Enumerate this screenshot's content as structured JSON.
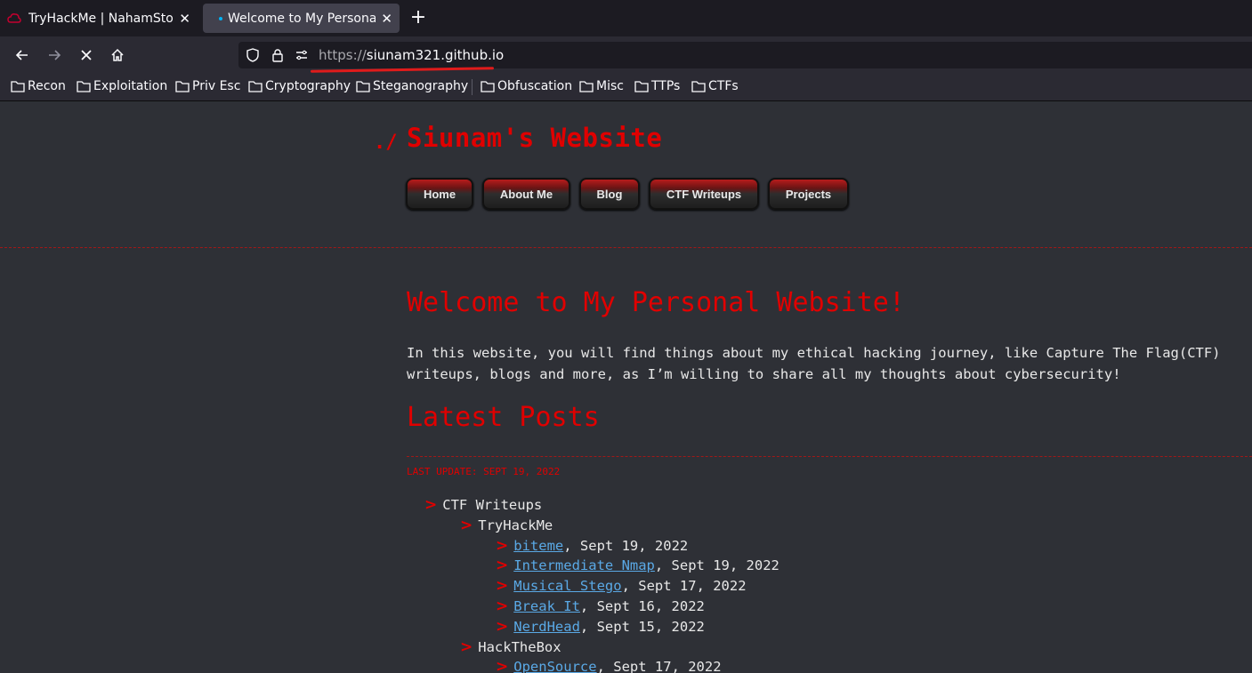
{
  "browser": {
    "tabs": [
      {
        "title": "TryHackMe | NahamStore",
        "active": false
      },
      {
        "title": "Welcome to My Personal",
        "active": true
      }
    ],
    "new_tab_label": "+",
    "url_scheme": "https://",
    "url_host": "siunam321.github.io",
    "bookmarks": [
      "Recon",
      "Exploitation",
      "Priv Esc",
      "Cryptography",
      "Steganography",
      "Obfuscation",
      "Misc",
      "TTPs",
      "CTFs"
    ]
  },
  "site": {
    "prefix": "./",
    "title": "Siunam's Website",
    "menu": [
      "Home",
      "About Me",
      "Blog",
      "CTF Writeups",
      "Projects"
    ],
    "welcome_heading": "Welcome to My Personal Website!",
    "intro_line1": "In this website, you will find things about my ethical hacking journey, like Capture The Flag(CTF)",
    "intro_line2": "writeups, blogs and more, as I’m willing to share all my thoughts about cybersecurity!",
    "latest_heading": "Latest Posts",
    "last_update": "LAST UPDATE: SEPT 19, 2022",
    "arrow": ">",
    "ctf_section": "CTF Writeups",
    "thm_section": "TryHackMe",
    "htb_section": "HackTheBox",
    "thm_posts": [
      {
        "title": "biteme",
        "date": ", Sept 19, 2022"
      },
      {
        "title": "Intermediate Nmap",
        "date": ", Sept 19, 2022"
      },
      {
        "title": "Musical Stego",
        "date": ", Sept 17, 2022"
      },
      {
        "title": "Break It",
        "date": ", Sept 16, 2022"
      },
      {
        "title": "NerdHead",
        "date": ", Sept 15, 2022"
      }
    ],
    "htb_posts": [
      {
        "title": "OpenSource",
        "date": ", Sept 17, 2022"
      }
    ]
  },
  "colors": {
    "accent": "#e00000",
    "link": "#5aa9e6",
    "page_bg": "#2e3036"
  }
}
